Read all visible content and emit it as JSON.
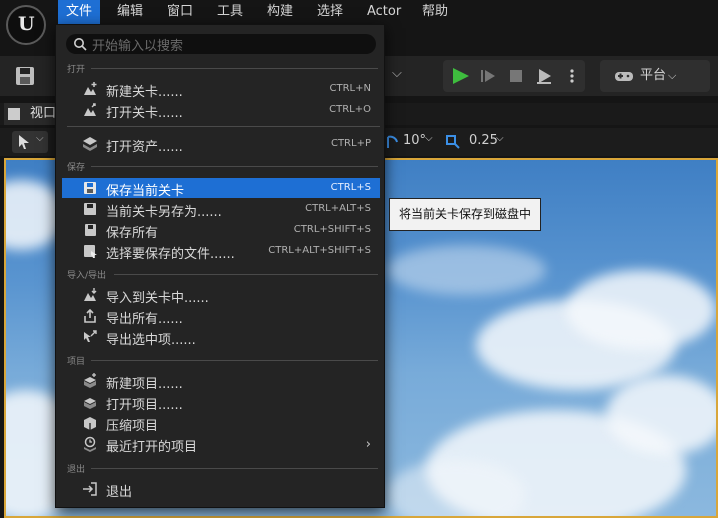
{
  "menubar": {
    "logo": "U",
    "items": [
      "文件",
      "编辑",
      "窗口",
      "工具",
      "构建",
      "选择",
      "Actor",
      "帮助"
    ]
  },
  "toolbar": {
    "platform_label": "平台"
  },
  "viewport": {
    "tab_label": "视口",
    "rotation_snap": "10°",
    "scale_snap": "0.25"
  },
  "file_menu": {
    "search_placeholder": "开始输入以搜索",
    "sections": {
      "open": "打开",
      "save": "保存",
      "import_export": "导入/导出",
      "project": "项目",
      "exit": "退出"
    },
    "items": [
      {
        "label": "新建关卡......",
        "shortcut": "CTRL+N",
        "icon": "new-level-icon"
      },
      {
        "label": "打开关卡......",
        "shortcut": "CTRL+O",
        "icon": "open-level-icon"
      },
      {
        "label": "打开资产......",
        "shortcut": "CTRL+P",
        "icon": "open-asset-icon"
      },
      {
        "label": "保存当前关卡",
        "shortcut": "CTRL+S",
        "icon": "save-icon"
      },
      {
        "label": "当前关卡另存为......",
        "shortcut": "CTRL+ALT+S",
        "icon": "save-as-icon"
      },
      {
        "label": "保存所有",
        "shortcut": "CTRL+SHIFT+S",
        "icon": "save-all-icon"
      },
      {
        "label": "选择要保存的文件......",
        "shortcut": "CTRL+ALT+SHIFT+S",
        "icon": "choose-files-icon"
      },
      {
        "label": "导入到关卡中......",
        "shortcut": "",
        "icon": "import-icon"
      },
      {
        "label": "导出所有......",
        "shortcut": "",
        "icon": "export-all-icon"
      },
      {
        "label": "导出选中项......",
        "shortcut": "",
        "icon": "export-selected-icon"
      },
      {
        "label": "新建项目......",
        "shortcut": "",
        "icon": "new-project-icon"
      },
      {
        "label": "打开项目......",
        "shortcut": "",
        "icon": "open-project-icon"
      },
      {
        "label": "压缩项目",
        "shortcut": "",
        "icon": "zip-project-icon"
      },
      {
        "label": "最近打开的项目",
        "shortcut": "",
        "icon": "recent-projects-icon"
      },
      {
        "label": "退出",
        "shortcut": "",
        "icon": "exit-icon"
      }
    ],
    "submenu_arrow": "›"
  },
  "tooltip": {
    "text": "将当前关卡保存到磁盘中"
  },
  "colors": {
    "accent": "#1e6fd4",
    "play": "#3ebd3e",
    "viewport_border": "#d8a63a"
  }
}
